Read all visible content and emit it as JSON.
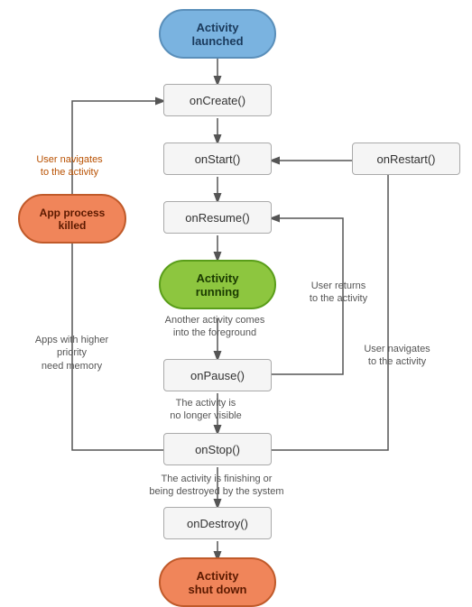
{
  "nodes": {
    "activity_launched": "Activity\nlaunched",
    "on_create": "onCreate()",
    "on_start": "onStart()",
    "on_resume": "onResume()",
    "activity_running": "Activity\nrunning",
    "on_pause": "onPause()",
    "on_stop": "onStop()",
    "on_destroy": "onDestroy()",
    "activity_shut_down": "Activity\nshut down",
    "on_restart": "onRestart()",
    "app_process_killed": "App process\nkilled"
  },
  "labels": {
    "user_navigates_to_activity": "User navigates\nto the activity",
    "another_activity": "Another activity comes\ninto the foreground",
    "user_returns": "User returns\nto the activity",
    "no_longer_visible": "The activity is\nno longer visible",
    "user_navigates_to_activity2": "User navigates\nto the activity",
    "finishing_or_destroyed": "The activity is finishing or\nbeing destroyed by the system",
    "apps_higher_priority": "Apps with higher priority\nneed memory"
  }
}
